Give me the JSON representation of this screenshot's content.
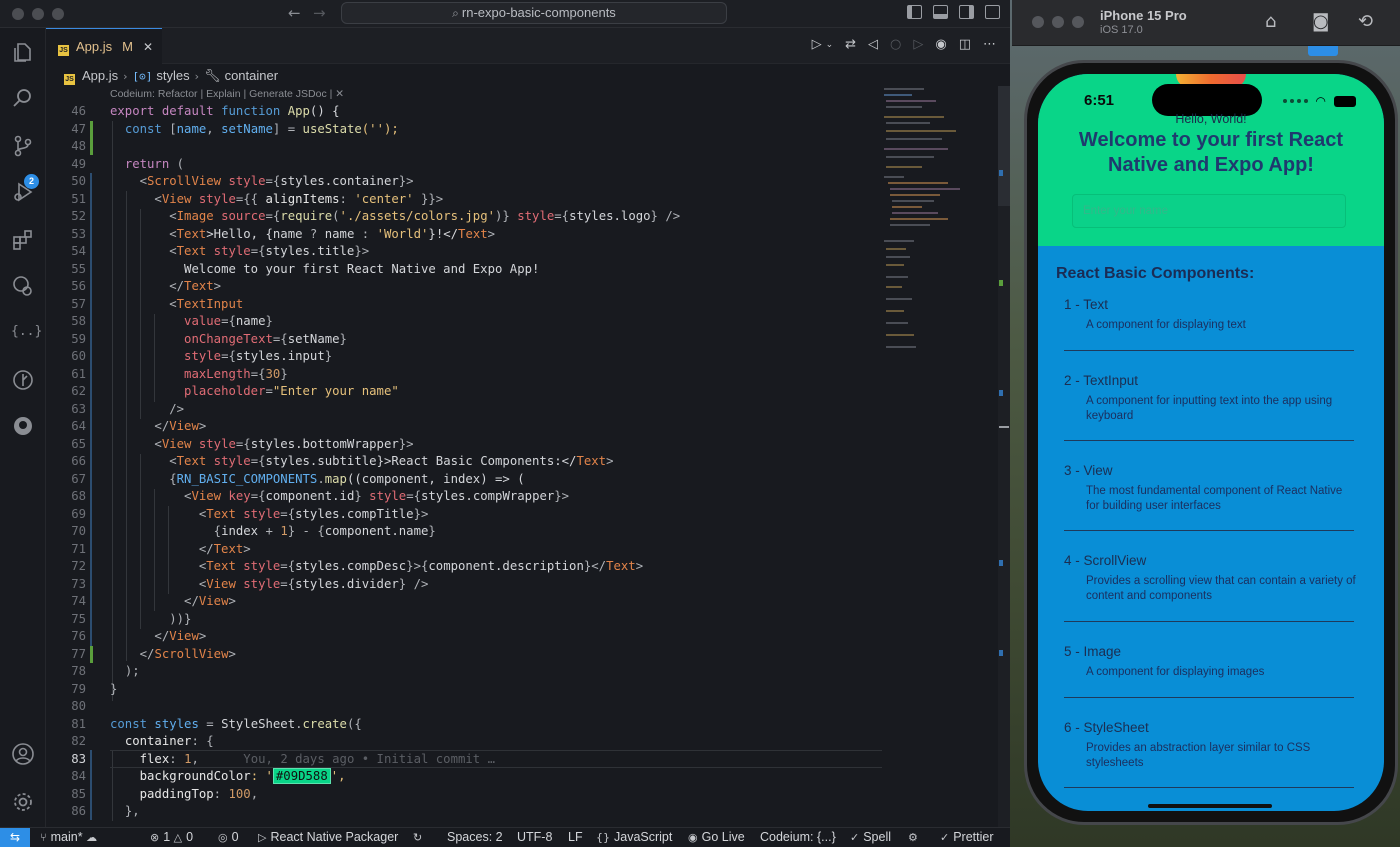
{
  "titlebar": {
    "search": "rn-expo-basic-components"
  },
  "tab": {
    "icon": "JS",
    "label": "App.js",
    "status": "M"
  },
  "breadcrumbs": {
    "file": "App.js",
    "symbol1": "styles",
    "symbol2": "container"
  },
  "activity": {
    "source_control_badge": "2"
  },
  "codelens": "Codeium: Refactor | Explain | Generate JSDoc | ✕",
  "lines": {
    "n46": "46",
    "n47": "47",
    "n48": "48",
    "n49": "49",
    "n50": "50",
    "n51": "51",
    "n52": "52",
    "n53": "53",
    "n54": "54",
    "n55": "55",
    "n56": "56",
    "n57": "57",
    "n58": "58",
    "n59": "59",
    "n60": "60",
    "n61": "61",
    "n62": "62",
    "n63": "63",
    "n64": "64",
    "n65": "65",
    "n66": "66",
    "n67": "67",
    "n68": "68",
    "n69": "69",
    "n70": "70",
    "n71": "71",
    "n72": "72",
    "n73": "73",
    "n74": "74",
    "n75": "75",
    "n76": "76",
    "n77": "77",
    "n78": "78",
    "n79": "79",
    "n80": "80",
    "n81": "81",
    "n82": "82",
    "n83": "83",
    "n84": "84",
    "n85": "85",
    "n86": "86"
  },
  "code": {
    "l46a": "export",
    "l46b": "default",
    "l46c": "function",
    "l46d": "App",
    "l46e": "() {",
    "l47a": "const",
    "l47b": " [",
    "l47c": "name",
    "l47d": ", ",
    "l47e": "setName",
    "l47f": "] = ",
    "l47g": "useState",
    "l47h": "('');",
    "l49a": "return",
    "l49b": " (",
    "l50a": "<",
    "l50b": "ScrollView",
    "l50c": " style",
    "l50d": "={",
    "l50e": "styles.container",
    "l50f": "}>",
    "l51a": "<",
    "l51b": "View",
    "l51c": " style",
    "l51d": "={{ ",
    "l51e": "alignItems",
    "l51f": ": ",
    "l51g": "'center'",
    "l51h": " }}>",
    "l52a": "<",
    "l52b": "Image",
    "l52c": " source",
    "l52d": "={",
    "l52e": "require",
    "l52f": "(",
    "l52g": "'./assets/colors.jpg'",
    "l52h": ")} ",
    "l52i": "style",
    "l52j": "={",
    "l52k": "styles.logo",
    "l52l": "} />",
    "l53a": "<",
    "l53b": "Text",
    "l53c": ">Hello, {",
    "l53d": "name",
    "l53e": " ? ",
    "l53f": "name",
    "l53g": " : ",
    "l53h": "'World'",
    "l53i": "}!</",
    "l53j": "Text",
    "l53k": ">",
    "l54a": "<",
    "l54b": "Text",
    "l54c": " style",
    "l54d": "={",
    "l54e": "styles.title",
    "l54f": "}>",
    "l55": "Welcome to your first React Native and Expo App!",
    "l56a": "</",
    "l56b": "Text",
    "l56c": ">",
    "l57a": "<",
    "l57b": "TextInput",
    "l58a": "value",
    "l58b": "={",
    "l58c": "name",
    "l58d": "}",
    "l59a": "onChangeText",
    "l59b": "={",
    "l59c": "setName",
    "l59d": "}",
    "l60a": "style",
    "l60b": "={",
    "l60c": "styles.input",
    "l60d": "}",
    "l61a": "maxLength",
    "l61b": "={",
    "l61c": "30",
    "l61d": "}",
    "l62a": "placeholder",
    "l62b": "=",
    "l62c": "\"Enter your name\"",
    "l63": "/>",
    "l64a": "</",
    "l64b": "View",
    "l64c": ">",
    "l65a": "<",
    "l65b": "View",
    "l65c": " style",
    "l65d": "={",
    "l65e": "styles.bottomWrapper",
    "l65f": "}>",
    "l66a": "<",
    "l66b": "Text",
    "l66c": " style",
    "l66d": "={",
    "l66e": "styles.subtitle",
    "l66f": "}>React Basic Components:</",
    "l66g": "Text",
    "l66h": ">",
    "l67a": "{",
    "l67b": "RN_BASIC_COMPONENTS",
    "l67c": ".",
    "l67d": "map",
    "l67e": "((component, index) => (",
    "l68a": "<",
    "l68b": "View",
    "l68c": " key",
    "l68d": "={",
    "l68e": "component.id",
    "l68f": "} ",
    "l68g": "style",
    "l68h": "={",
    "l68i": "styles.compWrapper",
    "l68j": "}>",
    "l69a": "<",
    "l69b": "Text",
    "l69c": " style",
    "l69d": "={",
    "l69e": "styles.compTitle",
    "l69f": "}>",
    "l70a": "{",
    "l70b": "index",
    "l70c": " + ",
    "l70d": "1",
    "l70e": "} - {",
    "l70f": "component.name",
    "l70g": "}",
    "l71a": "</",
    "l71b": "Text",
    "l71c": ">",
    "l72a": "<",
    "l72b": "Text",
    "l72c": " style",
    "l72d": "={",
    "l72e": "styles.compDesc",
    "l72f": "}>{",
    "l72g": "component.description",
    "l72h": "}</",
    "l72i": "Text",
    "l72j": ">",
    "l73a": "<",
    "l73b": "View",
    "l73c": " style",
    "l73d": "={",
    "l73e": "styles.divider",
    "l73f": "} />",
    "l74a": "</",
    "l74b": "View",
    "l74c": ">",
    "l75": "))}",
    "l76a": "</",
    "l76b": "View",
    "l76c": ">",
    "l77a": "</",
    "l77b": "ScrollView",
    "l77c": ">",
    "l78": ");",
    "l79": "}",
    "l81a": "const",
    "l81b": " styles",
    "l81c": " = ",
    "l81d": "StyleSheet",
    "l81e": ".",
    "l81f": "create",
    "l81g": "({",
    "l82a": "container",
    "l82b": ": {",
    "l83a": "flex",
    "l83b": ": ",
    "l83c": "1",
    "l83d": ",",
    "l83e": "You, 2 days ago • Initial commit …",
    "l84a": "backgroundColor",
    "l84b": ": '",
    "l84c": "#09D588",
    "l84d": "',",
    "l85a": "paddingTop",
    "l85b": ": ",
    "l85c": "100",
    "l85d": ",",
    "l86": "},"
  },
  "statusbar": {
    "branch": "main*",
    "errors": "1",
    "warnings": "0",
    "ports": "0",
    "packager": "React Native Packager",
    "spaces": "Spaces: 2",
    "encoding": "UTF-8",
    "eol": "LF",
    "language": "JavaScript",
    "golive": "Go Live",
    "codeium": "Codeium: {...}",
    "spell": "Spell",
    "prettier": "Prettier"
  },
  "simulator": {
    "device": "iPhone 15 Pro",
    "os": "iOS 17.0"
  },
  "phone": {
    "time": "6:51",
    "hello": "Hello, World!",
    "title": "Welcome to your first React Native and Expo App!",
    "input_placeholder": "Enter your name",
    "subtitle": "React Basic Components:",
    "components": [
      {
        "title": "1 - Text",
        "desc": "A component for displaying text"
      },
      {
        "title": "2 - TextInput",
        "desc": "A component for inputting text into the app using keyboard"
      },
      {
        "title": "3 - View",
        "desc": "The most fundamental component of React Native for building user interfaces"
      },
      {
        "title": "4 - ScrollView",
        "desc": "Provides a scrolling view that can contain a variety of content and components"
      },
      {
        "title": "5 - Image",
        "desc": "A component for displaying images"
      },
      {
        "title": "6 - StyleSheet",
        "desc": "Provides an abstraction layer similar to CSS stylesheets"
      }
    ]
  },
  "colors": {
    "accent": "#2d8ee6",
    "app_top": "#09D588",
    "app_bottom": "#098ed6"
  }
}
